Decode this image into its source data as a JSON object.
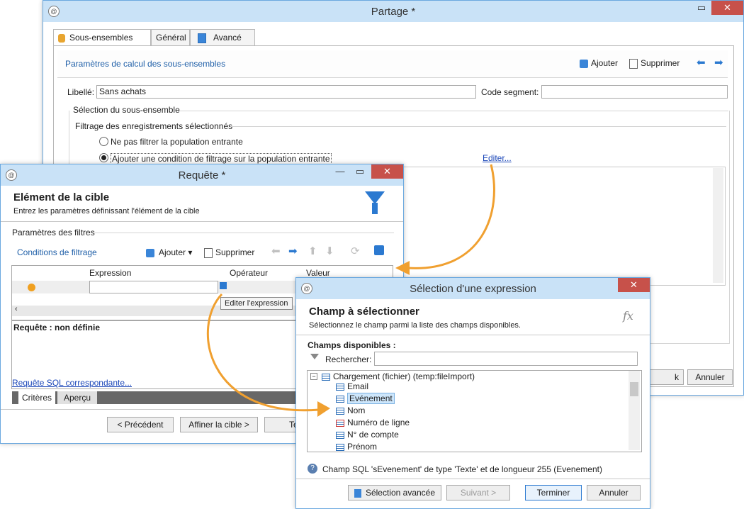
{
  "partage": {
    "title": "Partage *",
    "tabs": [
      "Sous-ensembles",
      "Général",
      "Avancé"
    ],
    "section_title": "Paramètres de calcul des sous-ensembles",
    "add_label": "Ajouter",
    "delete_label": "Supprimer",
    "libelle_label": "Libellé:",
    "libelle_value": "Sans achats",
    "code_label": "Code segment:",
    "code_value": "",
    "subset_group": "Sélection du sous-ensemble",
    "filter_group": "Filtrage des enregistrements sélectionnés",
    "radio1": "Ne pas filtrer la population entrante",
    "radio2": "Ajouter une condition de filtrage sur la population entrante",
    "edit_link": "Editer...",
    "ok_label": "k",
    "cancel_label": "Annuler"
  },
  "requete": {
    "title": "Requête *",
    "heading": "Elément de la cible",
    "subheading": "Entrez les paramètres définissant l'élément de la cible",
    "params_label": "Paramètres des filtres",
    "conditions_label": "Conditions de filtrage",
    "add_label": "Ajouter",
    "delete_label": "Supprimer",
    "col_expression": "Expression",
    "col_operator": "Opérateur",
    "col_value": "Valeur",
    "tooltip": "Editer l'expression",
    "status": "Requête : non définie",
    "sql_link": "Requête SQL correspondante...",
    "tab_criteres": "Critères",
    "tab_apercu": "Aperçu",
    "btn_prev": "< Précédent",
    "btn_refine": "Affiner la cible >",
    "btn_partial": "Te"
  },
  "selection": {
    "title": "Sélection d'une expression",
    "heading": "Champ à sélectionner",
    "subheading": "Sélectionnez le champ parmi la liste des champs disponibles.",
    "fx": "fx",
    "available_label": "Champs disponibles :",
    "search_label": "Rechercher:",
    "search_value": "",
    "tree_root": "Chargement (fichier) (temp:fileImport)",
    "tree_items": [
      "Email",
      "Evénement",
      "Nom",
      "Numéro de ligne",
      "N° de compte",
      "Prénom"
    ],
    "info": "Champ SQL 'sEvenement' de type 'Texte' et de longueur 255 (Evenement)",
    "btn_advanced": "Sélection avancée",
    "btn_next": "Suivant >",
    "btn_finish": "Terminer",
    "btn_cancel": "Annuler"
  },
  "colors": {
    "accent": "#2b79d0",
    "arrow": "#f0a030",
    "close": "#c7514a",
    "titlebar": "#c9e2f7"
  }
}
